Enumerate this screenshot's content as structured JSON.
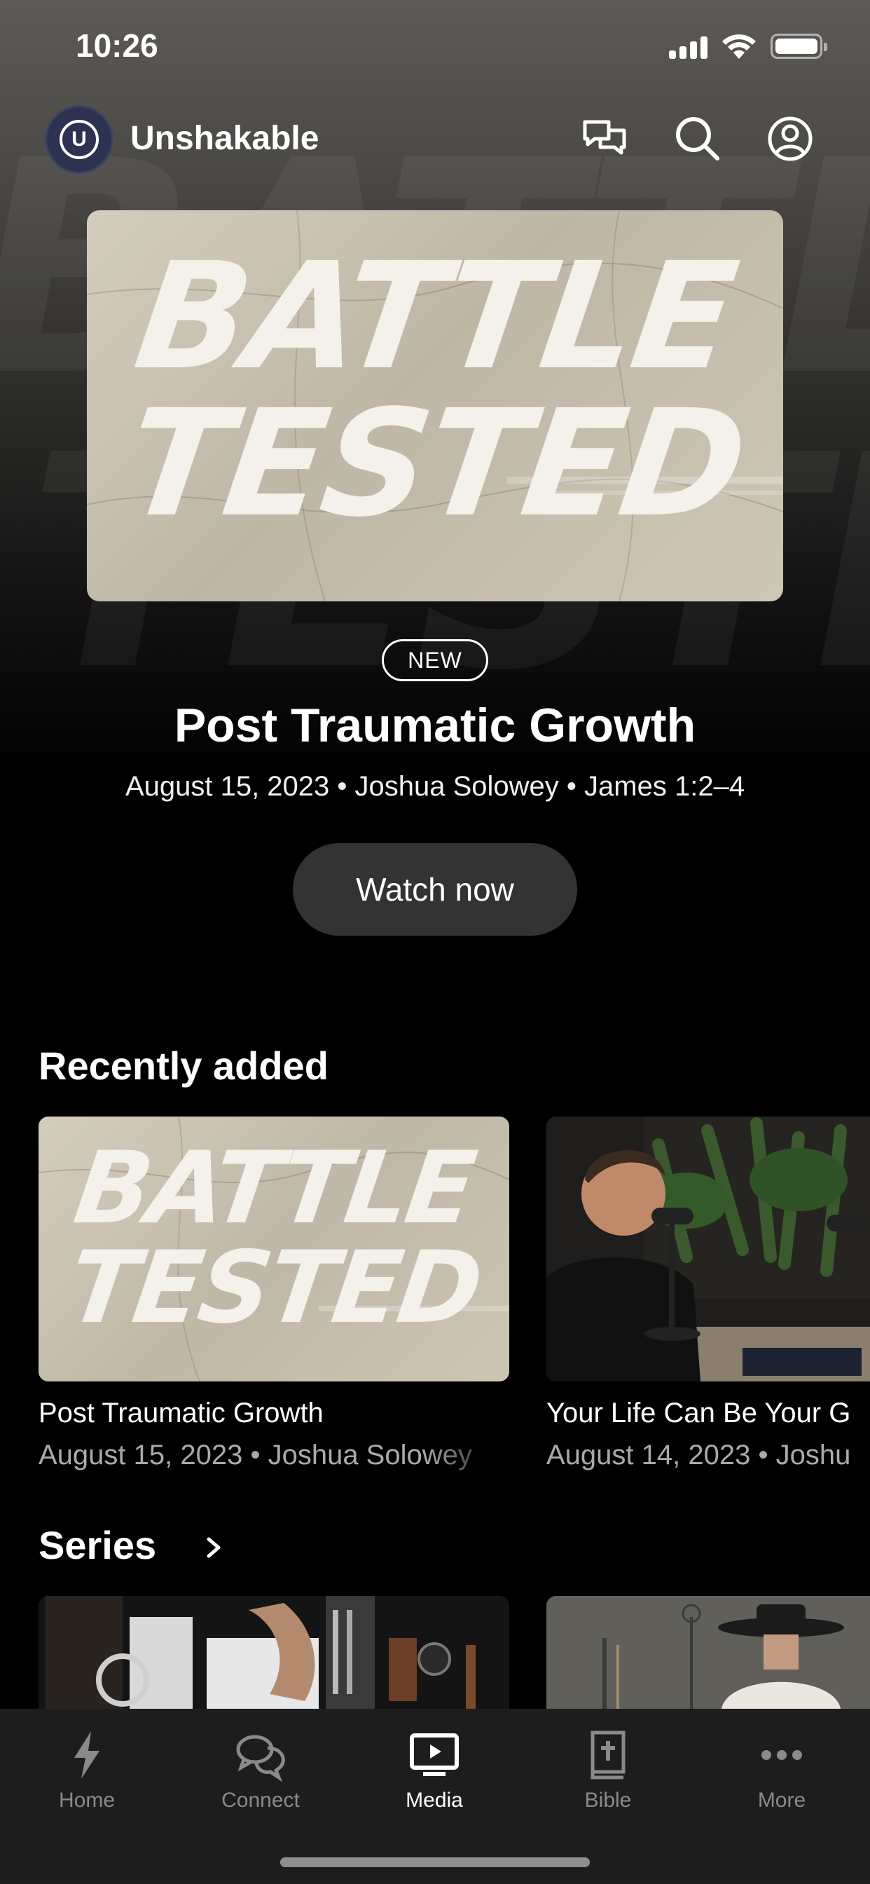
{
  "status_bar": {
    "time": "10:26"
  },
  "header": {
    "app_name": "Unshakable",
    "logo_letter": "U"
  },
  "hero": {
    "art_line1": "BATTLE",
    "art_line2": "TESTED",
    "badge": "NEW",
    "title": "Post Traumatic Growth",
    "meta": "August 15, 2023 • Joshua Solowey • James 1:2–4",
    "cta": "Watch now"
  },
  "recently_added": {
    "heading": "Recently added",
    "items": [
      {
        "title": "Post Traumatic Growth",
        "meta": "August 15, 2023 • Joshua Solowey",
        "art_line1": "BATTLE",
        "art_line2": "TESTED"
      },
      {
        "title": "Your Life Can Be Your G",
        "meta": "August 14, 2023 • Joshu"
      }
    ]
  },
  "series": {
    "heading": "Series"
  },
  "tabs": [
    {
      "label": "Home",
      "icon": "bolt-icon",
      "active": false
    },
    {
      "label": "Connect",
      "icon": "chat-bubbles-icon",
      "active": false
    },
    {
      "label": "Media",
      "icon": "play-screen-icon",
      "active": true
    },
    {
      "label": "Bible",
      "icon": "bible-icon",
      "active": false
    },
    {
      "label": "More",
      "icon": "more-dots-icon",
      "active": false
    }
  ]
}
